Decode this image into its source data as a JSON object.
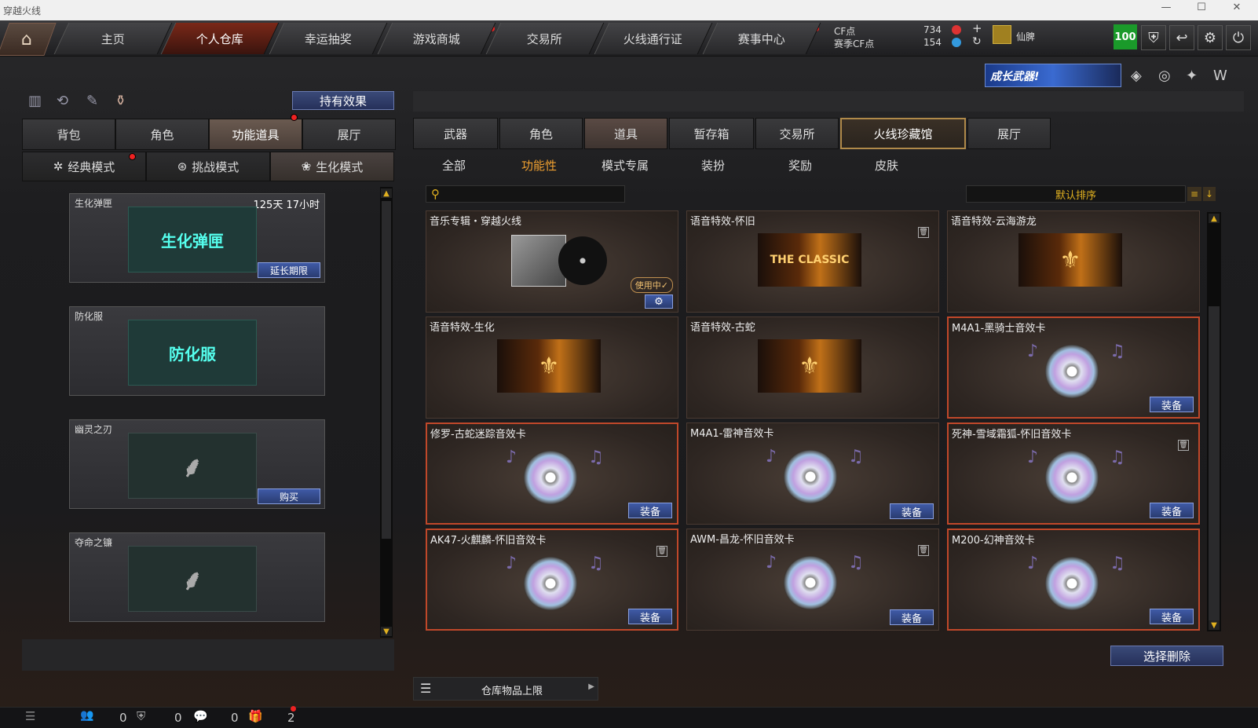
{
  "window": {
    "title": "穿越火线",
    "minimize": "—",
    "maximize": "☐",
    "close": "✕"
  },
  "nav": {
    "home_icon": "house-icon",
    "tabs": [
      "主页",
      "个人仓库",
      "幸运抽奖",
      "游戏商城",
      "交易所",
      "火线通行证",
      "赛事中心"
    ],
    "active": "个人仓库",
    "cf_label": "CF点",
    "season_cf_label": "赛季CF点",
    "cf_value": "734",
    "season_cf_value": "154",
    "plus": "+",
    "refresh": "↻",
    "username": "仙脾",
    "level_badge": "100"
  },
  "banner": {
    "text": "成长武器!"
  },
  "left": {
    "hold_effect": "持有效果",
    "tabs": [
      "背包",
      "角色",
      "功能道具",
      "展厅"
    ],
    "active_tab": "功能道具",
    "modes": [
      "经典模式",
      "挑战模式",
      "生化模式"
    ],
    "active_mode": "生化模式",
    "items": [
      {
        "name": "生化弹匣",
        "time": "125天 17小时",
        "art": "生化弹匣",
        "button": "延长期限"
      },
      {
        "name": "防化服",
        "time": "",
        "art": "防化服",
        "button": ""
      },
      {
        "name": "幽灵之刃",
        "time": "",
        "art": "",
        "button": "购买"
      },
      {
        "name": "夺命之镰",
        "time": "",
        "art": "",
        "button": ""
      }
    ]
  },
  "right": {
    "tabs": [
      "武器",
      "角色",
      "道具",
      "暂存箱",
      "交易所",
      "火线珍藏馆",
      "展厅"
    ],
    "active_tab": "道具",
    "gold_tab": "火线珍藏馆",
    "subtabs": [
      "全部",
      "功能性",
      "模式专属",
      "装扮",
      "奖励",
      "皮肤"
    ],
    "active_subtab": "功能性",
    "search_placeholder": "",
    "sort_label": "默认排序",
    "items": [
      {
        "name": "音乐专辑・穿越火线",
        "type": "album",
        "badge": "使用中✓",
        "button": ""
      },
      {
        "name": "语音特效-怀旧",
        "type": "voice",
        "art": "THE CLASSIC",
        "button": "",
        "trash": true
      },
      {
        "name": "语音特效-云海游龙",
        "type": "voice",
        "art": "",
        "button": ""
      },
      {
        "name": "语音特效-生化",
        "type": "voice",
        "art": "",
        "button": ""
      },
      {
        "name": "语音特效-古蛇",
        "type": "voice",
        "art": "",
        "button": ""
      },
      {
        "name": "M4A1-黑骑士音效卡",
        "type": "disc",
        "button": "装备",
        "hl": true
      },
      {
        "name": "修罗-古蛇迷踪音效卡",
        "type": "disc",
        "button": "装备",
        "hl": true
      },
      {
        "name": "M4A1-雷神音效卡",
        "type": "disc",
        "button": "装备"
      },
      {
        "name": "死神-雪域霜狐-怀旧音效卡",
        "type": "disc",
        "button": "装备",
        "hl": true,
        "trash": true
      },
      {
        "name": "AK47-火麒麟-怀旧音效卡",
        "type": "disc",
        "button": "装备",
        "hl": true,
        "trash": true
      },
      {
        "name": "AWM-昌龙-怀旧音效卡",
        "type": "disc",
        "button": "装备",
        "trash": true
      },
      {
        "name": "M200-幻神音效卡",
        "type": "disc",
        "button": "装备",
        "hl": true
      }
    ],
    "select_delete": "选择删除",
    "storage_limit": "仓库物品上限"
  },
  "statusbar": {
    "count1": "0",
    "count2": "0",
    "count3": "0",
    "count4": "2"
  }
}
